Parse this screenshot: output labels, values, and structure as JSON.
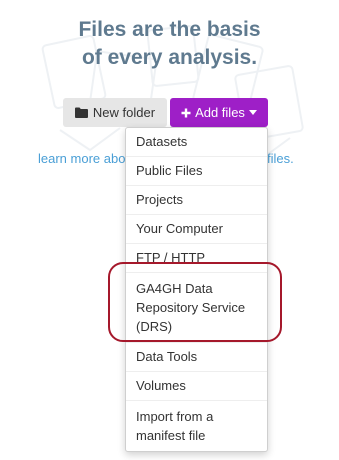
{
  "headline": {
    "line1": "Files are the basis",
    "line2": "of every analysis."
  },
  "toolbar": {
    "new_folder_label": "New folder",
    "add_files_label": "Add files"
  },
  "learn_more": {
    "left_text": "learn more abo",
    "right_text": "files."
  },
  "dropdown": {
    "items": [
      "Datasets",
      "Public Files",
      "Projects",
      "Your Computer",
      "FTP / HTTP",
      "GA4GH Data Repository Service (DRS)",
      "Data Tools",
      "Volumes",
      "Import from a manifest file"
    ],
    "highlighted_item": "GA4GH Data Repository Service (DRS)"
  },
  "colors": {
    "headline": "#5f7a8f",
    "add_files_bg": "#9e1fc7",
    "link": "#4a9fd6",
    "highlight_ring": "#a5182b"
  },
  "icons": {
    "new_folder": "folder-icon",
    "add_files": "plus-icon",
    "add_files_caret": "caret-down-icon"
  }
}
